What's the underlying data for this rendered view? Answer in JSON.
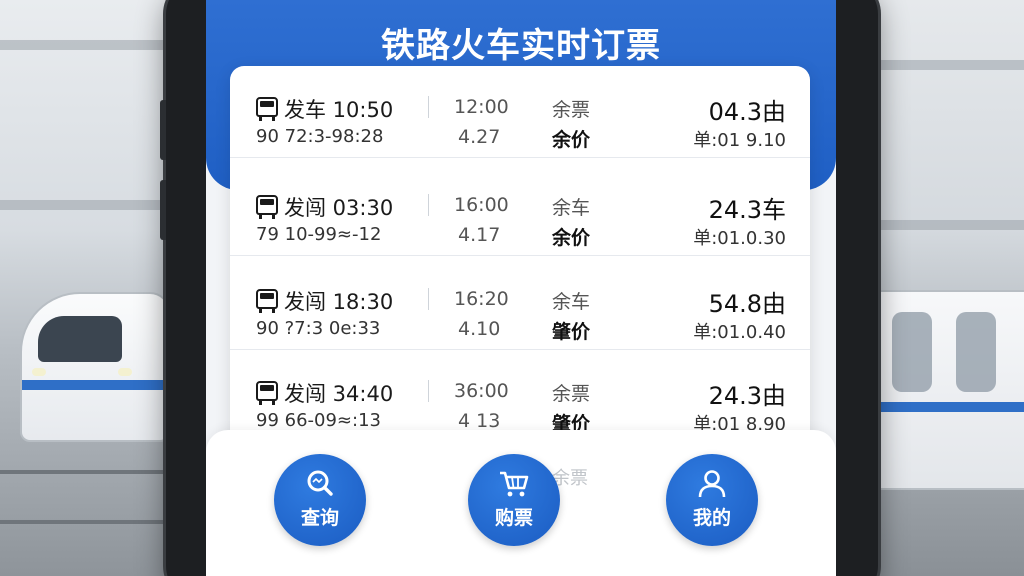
{
  "app": {
    "title": "铁路火车实时订票"
  },
  "trains": [
    {
      "depart": "发车 10:50",
      "code": "90 72:3-98:28",
      "time": "12:00",
      "duration": "4.27",
      "seat_label": "余票",
      "class_label": "余价",
      "price": "04.3",
      "price_unit": "由",
      "unit_price": "单:01 9.10"
    },
    {
      "depart": "发闯 03:30",
      "code": "79 10-99≈-12",
      "time": "16:00",
      "duration": "4.17",
      "seat_label": "余车",
      "class_label": "余价",
      "price": "24.3",
      "price_unit": "车",
      "unit_price": "单:01.0.30"
    },
    {
      "depart": "发闯 18:30",
      "code": "90 ?7:3 0e:33",
      "time": "16:20",
      "duration": "4.10",
      "seat_label": "余车",
      "class_label": "肇价",
      "price": "54.8",
      "price_unit": "由",
      "unit_price": "单:01.0.40"
    },
    {
      "depart": "发闯 34:40",
      "code": "99 66-09≈:13",
      "time": "36:00",
      "duration": "4 13",
      "seat_label": "余票",
      "class_label": "肇价",
      "price": "24.3",
      "price_unit": "由",
      "unit_price": "单:01 8.90"
    }
  ],
  "nav": {
    "query": {
      "label": "查询",
      "icon": "search-icon"
    },
    "buy": {
      "label": "购票",
      "icon": "cart-icon"
    },
    "mine": {
      "label": "我的",
      "icon": "user-icon"
    },
    "ghost": "余票"
  },
  "colors": {
    "primary": "#1f5fc4",
    "background": "#f2f4f7"
  }
}
